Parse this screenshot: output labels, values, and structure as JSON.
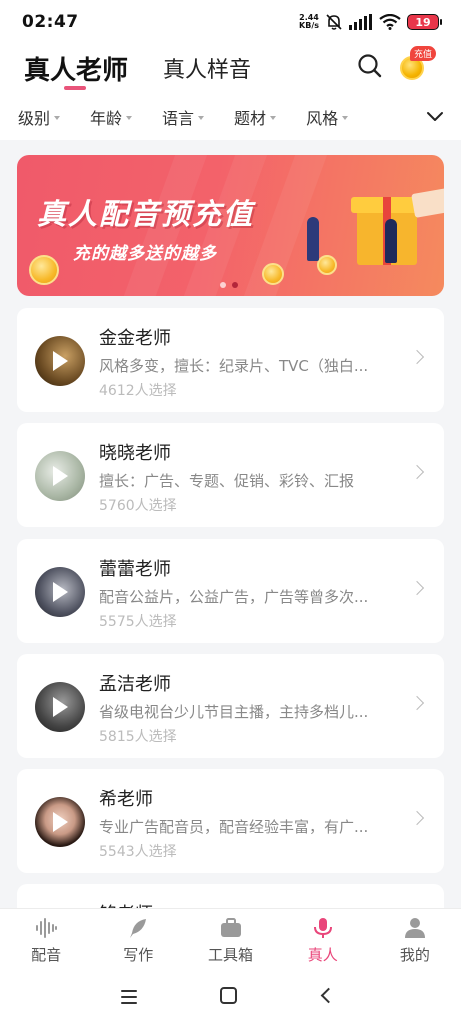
{
  "status_bar": {
    "time": "02:47",
    "net_speed_value": "2.44",
    "net_speed_unit": "KB/s",
    "battery": "19",
    "icons": [
      "mute-bell-icon",
      "signal-icon",
      "wifi-icon",
      "battery-icon"
    ]
  },
  "header": {
    "tabs": [
      {
        "label": "真人老师",
        "active": true
      },
      {
        "label": "真人样音",
        "active": false
      }
    ],
    "recharge_badge": "充值",
    "accent_color": "#e9547a"
  },
  "filters": [
    "级别",
    "年龄",
    "语言",
    "题材",
    "风格"
  ],
  "banner": {
    "title": "真人配音预充值",
    "subtitle": "充的越多送的越多",
    "page_count": 2,
    "active_page": 2
  },
  "teachers": [
    {
      "name": "金金老师",
      "desc": "风格多变，擅长：纪录片、TVC（独白...",
      "count": "4612人选择"
    },
    {
      "name": "晓晓老师",
      "desc": "擅长：广告、专题、促销、彩铃、汇报",
      "count": "5760人选择"
    },
    {
      "name": "蕾蕾老师",
      "desc": "配音公益片，公益广告，广告等曾多次...",
      "count": "5575人选择"
    },
    {
      "name": "孟洁老师",
      "desc": "省级电视台少儿节目主播，主持多档儿...",
      "count": "5815人选择"
    },
    {
      "name": "希老师",
      "desc": "专业广告配音员，配音经验丰富，有广...",
      "count": "5543人选择"
    },
    {
      "name": "铭老师",
      "desc": "",
      "count": ""
    }
  ],
  "bottom_nav": [
    {
      "label": "配音",
      "icon": "waveform-icon"
    },
    {
      "label": "写作",
      "icon": "feather-icon"
    },
    {
      "label": "工具箱",
      "icon": "toolbox-icon"
    },
    {
      "label": "真人",
      "icon": "microphone-icon",
      "active": true
    },
    {
      "label": "我的",
      "icon": "person-icon"
    }
  ],
  "active_nav_color": "#e9467a"
}
